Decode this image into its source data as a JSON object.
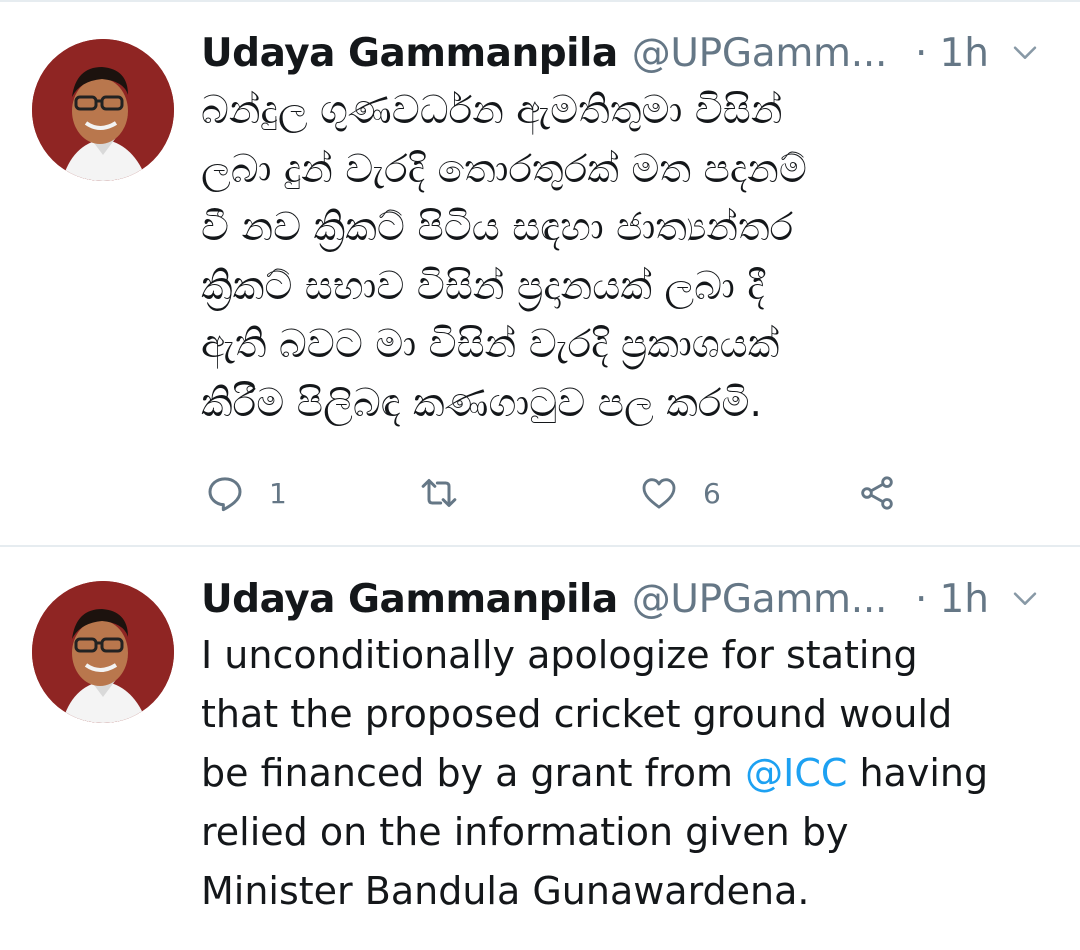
{
  "colors": {
    "text": "#14171a",
    "secondary": "#657786",
    "link": "#1da1f2",
    "divider": "#e6ecf0",
    "avatar_bg": "#8f2523"
  },
  "tweets": [
    {
      "name": "Udaya Gammanpila",
      "handle": "@UPGamm...",
      "dot": "·",
      "time": "1h",
      "lines": [
        "බන්දුල ගුණවර්ධන ඇමතිතුමා විසින්",
        "ලබා දුන් වැරදි තොරතුරක් මත පදනම්",
        "වී නව ක්‍රිකට් පිටිය සඳහා ජාත්‍යන්තර",
        "ක්‍රිකට් සභාව විසින් ප්‍රදානයක් ලබා දී",
        "ඇති බවට මා විසින් වැරදි ප්‍රකාශයක්",
        "කිරීම පිලිබඳ කණගාටුව පල කරමි."
      ],
      "icons": {
        "reply": "reply-icon",
        "retweet": "retweet-icon",
        "like": "like-icon",
        "share": "share-icon"
      },
      "reply_count": "1",
      "like_count": "6"
    },
    {
      "name": "Udaya Gammanpila",
      "handle": "@UPGamm...",
      "dot": "·",
      "time": "1h",
      "lines": [
        "I unconditionally apologize for stating",
        "that the proposed cricket ground would",
        "be financed by a grant from ",
        "relied on the information given by",
        "Minister Bandula Gunawardena."
      ],
      "mention": "@ICC",
      "line3_after": " having"
    }
  ]
}
